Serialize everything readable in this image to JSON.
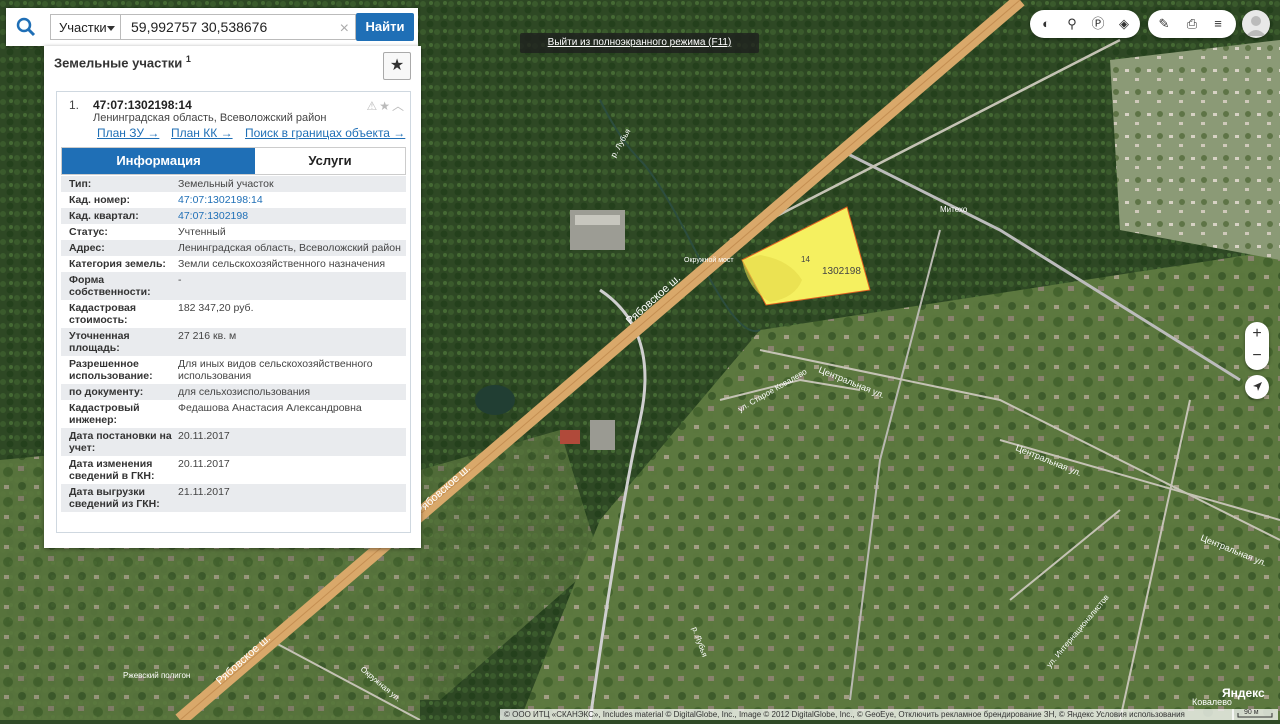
{
  "search": {
    "type_label": "Участки",
    "query": "59,992757 30,538676",
    "find_label": "Найти",
    "clear_label": "×"
  },
  "panel": {
    "title": "Земельные участки",
    "count": "1",
    "favorite_icon": "star-icon",
    "item": {
      "index": "1.",
      "cad_number": "47:07:1302198:14",
      "address": "Ленинградская область, Всеволожский район",
      "links": [
        "План ЗУ →",
        "План КК →",
        "Поиск в границах объекта →"
      ],
      "tabs": [
        "Информация",
        "Услуги"
      ],
      "rows": [
        {
          "k": "Тип:",
          "v": "Земельный участок"
        },
        {
          "k": "Кад. номер:",
          "v": "47:07:1302198:14",
          "link": true
        },
        {
          "k": "Кад. квартал:",
          "v": "47:07:1302198",
          "link": true
        },
        {
          "k": "Статус:",
          "v": "Учтенный"
        },
        {
          "k": "Адрес:",
          "v": "Ленинградская область, Всеволожский район"
        },
        {
          "k": "Категория земель:",
          "v": "Земли сельскохозяйственного назначения"
        },
        {
          "k": "Форма собственности:",
          "v": "-"
        },
        {
          "k": "Кадастровая стоимость:",
          "v": "182 347,20 руб."
        },
        {
          "k": "Уточненная площадь:",
          "v": "27 216 кв. м"
        },
        {
          "k": "Разрешенное использование:",
          "v": "Для иных видов сельскохозяйственного использования"
        },
        {
          "k": "по документу:",
          "v": "для сельхозиспользования"
        },
        {
          "k": "Кадастровый инженер:",
          "v": "Федашова Анастасия Александровна"
        },
        {
          "k": "Дата постановки на учет:",
          "v": "20.11.2017"
        },
        {
          "k": "Дата изменения сведений в ГКН:",
          "v": "20.11.2017"
        },
        {
          "k": "Дата выгрузки сведений из ГКН:",
          "v": "21.11.2017"
        }
      ]
    }
  },
  "fullscreen_notice": "Выйти из полноэкранного режима (F11)",
  "map": {
    "parcel_label_small": "14",
    "parcel_label": "1302198",
    "parcel_color": "#f5f060",
    "road_color": "#d9a86a",
    "labels": {
      "road_rjabovskoe_1": "Рябовское ш.",
      "road_rjabovskoe_2": "Рябовское ш.",
      "road_rjabovskoe_3": "Рябовское ш.",
      "okruzhnoy_most": "Окружной мост",
      "tsentralnaya_1": "Центральная ул.",
      "tsentralnaya_2": "Центральная ул.",
      "tsentralnaya_3": "Центральная ул.",
      "staroe_kovalevo": "ул. Старое Ковалево",
      "internatsionalistov": "ул. Интернационалистов",
      "lubya_1": "р. Лубья",
      "lubya_2": "р. Лубья",
      "mitekh": "Митехо",
      "zhevsky": "Ржевский полигон",
      "kovalevo": "Ковалево",
      "okruzhnaya": "Окружная ул."
    }
  },
  "toolbar": {
    "layers_icons": [
      "layers-icon",
      "route-icon",
      "parking-icon",
      "stack-icon"
    ],
    "tools_icons": [
      "ruler-icon",
      "print-icon",
      "menu-icon"
    ]
  },
  "zoom": {
    "in": "+",
    "out": "−"
  },
  "attribution": "© ООО ИТЦ «СКАНЭКС», Includes material © DigitalGlobe, Inc., Image © 2012 DigitalGlobe, Inc., © GeoEye, Отключить рекламное брендирование ЗН, © Яндекс Условия использования",
  "brand": "Яндекс",
  "scale": "90 м"
}
